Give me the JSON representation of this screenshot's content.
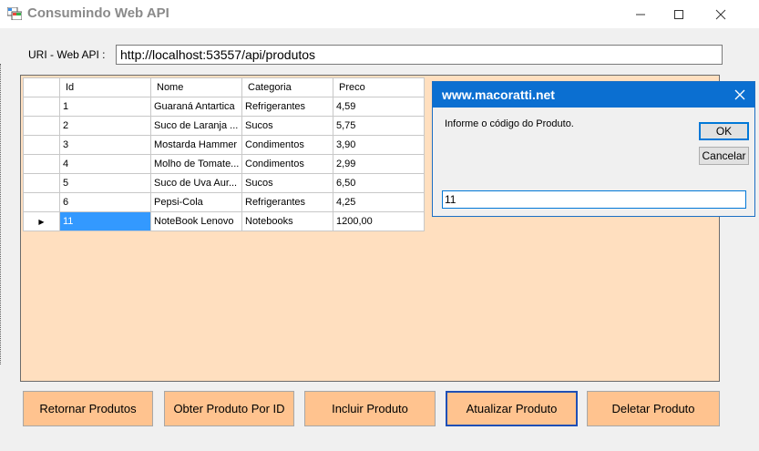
{
  "window": {
    "title": "Consumindo Web API",
    "controls": {
      "minimize_icon": "minimize-icon",
      "maximize_icon": "maximize-icon",
      "close_icon": "close-icon"
    }
  },
  "uri": {
    "label": "URI - Web API :",
    "value": "http://localhost:53557/api/produtos"
  },
  "grid": {
    "columns": [
      "Id",
      "Nome",
      "Categoria",
      "Preco"
    ],
    "rows": [
      [
        "1",
        "Guaraná Antartica",
        "Refrigerantes",
        "4,59"
      ],
      [
        "2",
        "Suco de Laranja ...",
        "Sucos",
        "5,75"
      ],
      [
        "3",
        "Mostarda Hammer",
        "Condimentos",
        "3,90"
      ],
      [
        "4",
        "Molho de Tomate...",
        "Condimentos",
        "2,99"
      ],
      [
        "5",
        "Suco de Uva Aur...",
        "Sucos",
        "6,50"
      ],
      [
        "6",
        "Pepsi-Cola",
        "Refrigerantes",
        "4,25"
      ],
      [
        "11",
        "NoteBook Lenovo",
        "Notebooks",
        "1200,00"
      ]
    ],
    "current_row_marker": "▶"
  },
  "dialog": {
    "title": "www.macoratti.net",
    "prompt": "Informe o código do Produto.",
    "ok_label": "OK",
    "cancel_label": "Cancelar",
    "input_value": "11"
  },
  "actions": {
    "retornar": "Retornar Produtos",
    "obter": "Obter Produto Por ID",
    "incluir": "Incluir Produto",
    "atualizar": "Atualizar Produto",
    "deletar": "Deletar Produto"
  },
  "colors": {
    "panel_bg": "#ffdfbf",
    "button_bg": "#ffc38f",
    "dialog_title_bg": "#0b6fd1",
    "selection": "#3399ff"
  }
}
